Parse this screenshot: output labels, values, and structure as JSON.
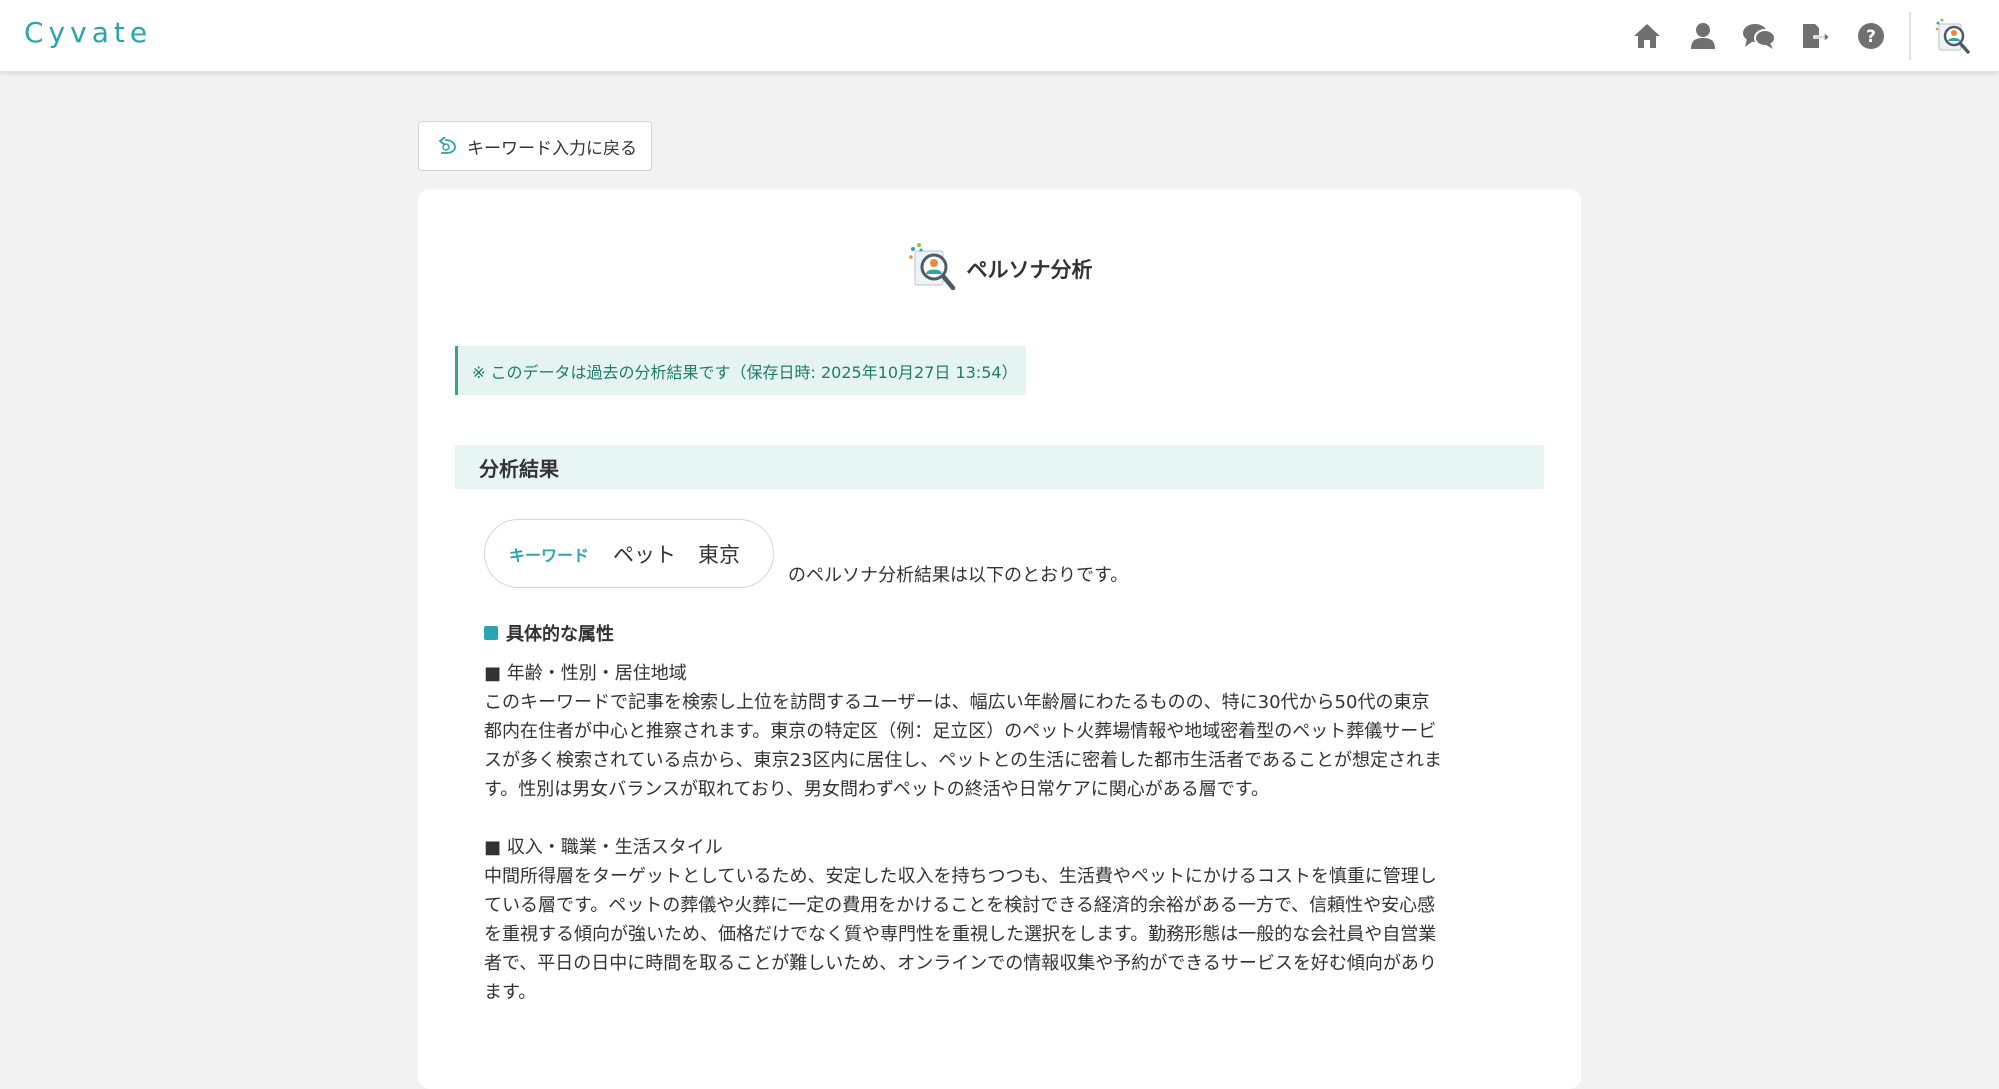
{
  "header": {
    "logo": "Cyvate",
    "nav": [
      {
        "name": "home-icon"
      },
      {
        "name": "user-icon"
      },
      {
        "name": "chat-icon"
      },
      {
        "name": "logout-icon"
      },
      {
        "name": "help-icon"
      }
    ],
    "avatar": "persona-avatar-icon"
  },
  "back_button": {
    "label": "キーワード入力に戻る"
  },
  "card": {
    "title": "ペルソナ分析",
    "notice": "※ このデータは過去の分析結果です（保存日時: 2025年10月27日 13:54）",
    "section_title": "分析結果",
    "keyword_label": "キーワード",
    "keywords": [
      "ペット",
      "東京"
    ],
    "intro": "のペルソナ分析結果は以下のとおりです。",
    "attr_heading": "具体的な属性",
    "blocks": [
      {
        "sub": "■ 年齢・性別・居住地域",
        "lines": [
          "このキーワードで記事を検索し上位を訪問するユーザーは、幅広い年齢層にわたるものの、特に30代から50代の東京",
          "都内在住者が中心と推察されます。東京の特定区（例：足立区）のペット火葬場情報や地域密着型のペット葬儀サービ",
          "スが多く検索されている点から、東京23区内に居住し、ペットとの生活に密着した都市生活者であることが想定されま",
          "す。性別は男女バランスが取れており、男女問わずペットの終活や日常ケアに関心がある層です。"
        ]
      },
      {
        "sub": "■ 収入・職業・生活スタイル",
        "lines": [
          "中間所得層をターゲットとしているため、安定した収入を持ちつつも、生活費やペットにかけるコストを慎重に管理し",
          "ている層です。ペットの葬儀や火葬に一定の費用をかけることを検討できる経済的余裕がある一方で、信頼性や安心感",
          "を重視する傾向が強いため、価格だけでなく質や専門性を重視した選択をします。勤務形態は一般的な会社員や自営業",
          "者で、平日の日中に時間を取ることが難しいため、オンラインでの情報収集や予約ができるサービスを好む傾向があり",
          "ます。"
        ]
      }
    ]
  },
  "colors": {
    "accent": "#2aa5ae",
    "notice_bg": "#e6f4f1",
    "notice_text": "#1f7b6a",
    "section_bg": "#e7f5f3",
    "nav_icon": "#707070"
  }
}
